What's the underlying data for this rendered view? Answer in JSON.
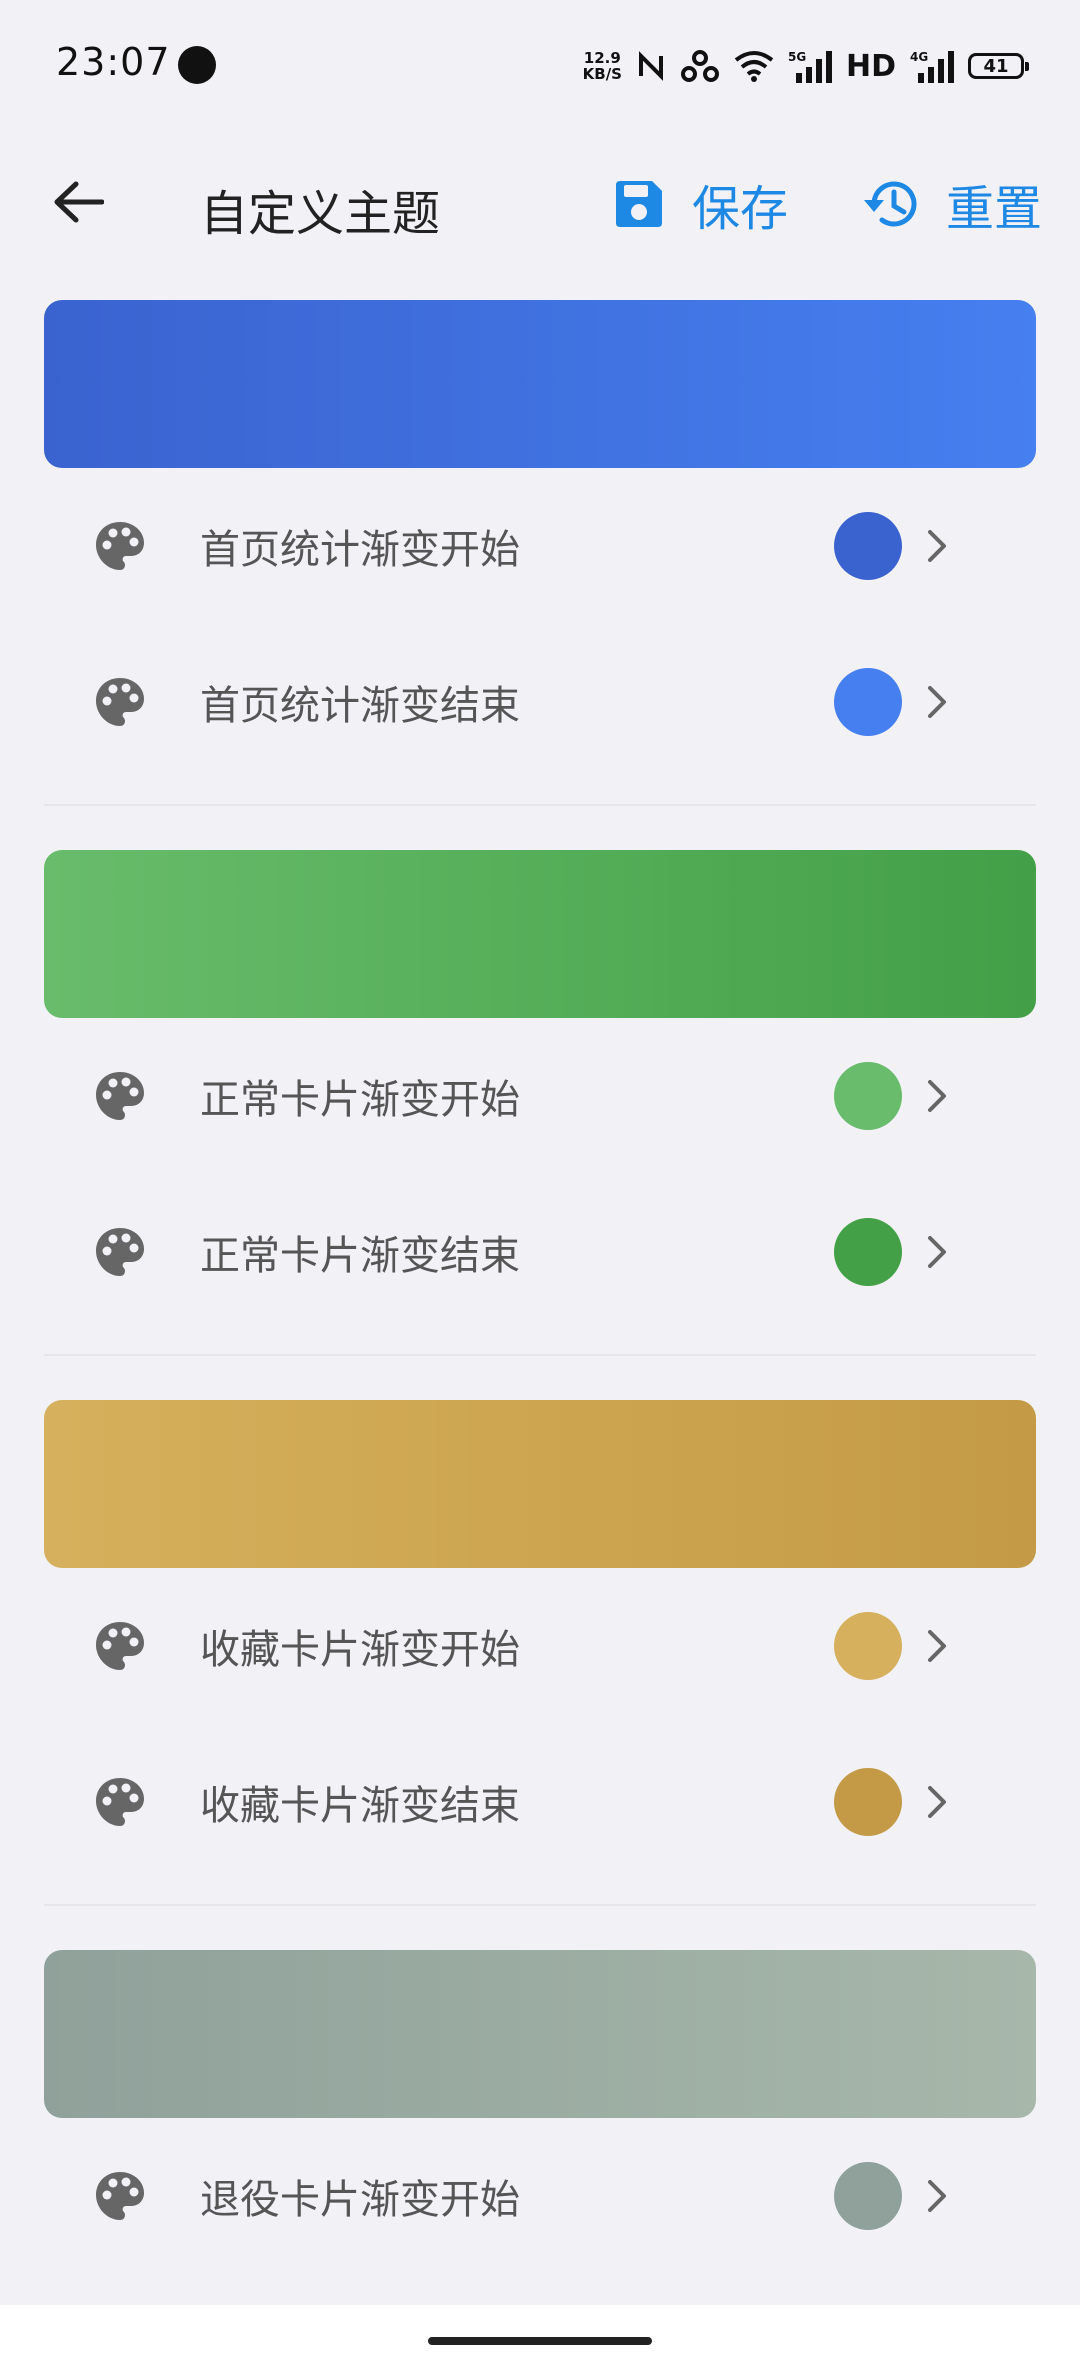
{
  "status_bar": {
    "time": "23:07",
    "speed_top": "12.9",
    "speed_bottom": "KB/S",
    "net1": "5G",
    "hd": "HD",
    "net2": "4G",
    "battery": "41"
  },
  "app_bar": {
    "title": "自定义主题",
    "save_label": "保存",
    "reset_label": "重置",
    "accent": "#1e88e5"
  },
  "groups": [
    {
      "gradient_start": "#3a63cf",
      "gradient_end": "#467ff0",
      "rows": [
        {
          "label": "首页统计渐变开始",
          "color": "#3a63cf",
          "icon": "palette-icon"
        },
        {
          "label": "首页统计渐变结束",
          "color": "#467ff0",
          "icon": "palette-icon"
        }
      ]
    },
    {
      "gradient_start": "#68bc6b",
      "gradient_end": "#43a047",
      "rows": [
        {
          "label": "正常卡片渐变开始",
          "color": "#68bc6b",
          "icon": "palette-icon"
        },
        {
          "label": "正常卡片渐变结束",
          "color": "#43a047",
          "icon": "palette-icon"
        }
      ]
    },
    {
      "gradient_start": "#d6b05c",
      "gradient_end": "#c49a46",
      "rows": [
        {
          "label": "收藏卡片渐变开始",
          "color": "#d6b05c",
          "icon": "palette-icon"
        },
        {
          "label": "收藏卡片渐变结束",
          "color": "#c49a46",
          "icon": "palette-icon"
        }
      ]
    },
    {
      "gradient_start": "#8fa19a",
      "gradient_end": "#a7b7aa",
      "rows": [
        {
          "label": "退役卡片渐变开始",
          "color": "#8fa19a",
          "icon": "palette-icon"
        }
      ]
    }
  ]
}
